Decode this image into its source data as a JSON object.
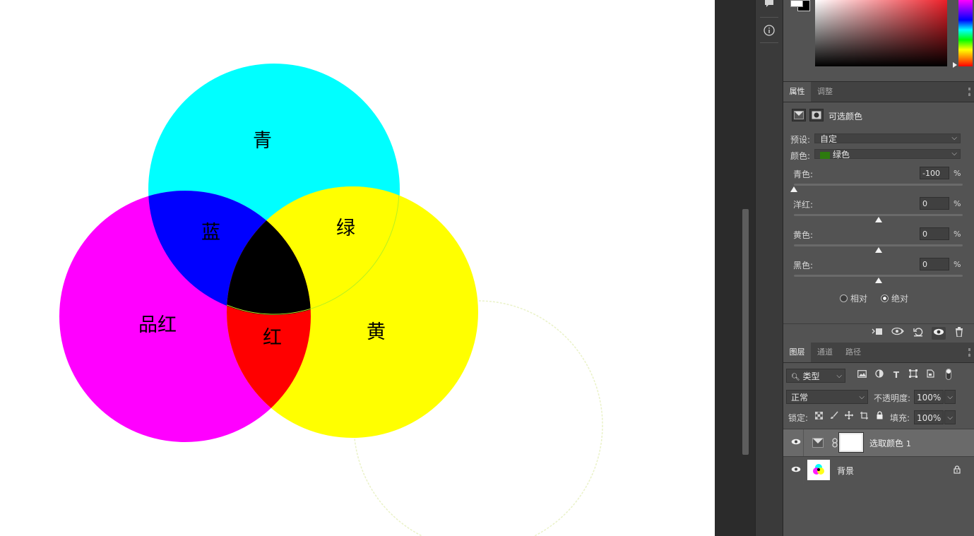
{
  "canvas": {
    "labels": {
      "cyan": "青",
      "blue": "蓝",
      "green": "绿",
      "magenta": "品红",
      "red": "红",
      "yellow": "黄"
    },
    "colors": {
      "cyan": "#00ffff",
      "blue": "#0000ff",
      "green_area": "#ffff00",
      "magenta": "#ff00ff",
      "red": "#ff0000",
      "yellow": "#ffff00",
      "center": "#000000",
      "ghost_circle": "#e6f0c0"
    }
  },
  "toolstrip": {
    "icons": [
      "comment-icon",
      "info-icon"
    ]
  },
  "properties_panel": {
    "tabs": [
      {
        "label": "属性",
        "active": true
      },
      {
        "label": "调整",
        "active": false
      }
    ],
    "adjustment_title": "可选颜色",
    "preset_label": "预设:",
    "preset_value": "自定",
    "color_label": "颜色:",
    "color_value": "绿色",
    "color_chip": "#2d7a0e",
    "sliders": [
      {
        "label": "青色:",
        "value": "-100",
        "unit": "%",
        "position": 0.0
      },
      {
        "label": "洋红:",
        "value": "0",
        "unit": "%",
        "position": 0.5
      },
      {
        "label": "黄色:",
        "value": "0",
        "unit": "%",
        "position": 0.5
      },
      {
        "label": "黑色:",
        "value": "0",
        "unit": "%",
        "position": 0.5
      }
    ],
    "method": {
      "relative_label": "相对",
      "absolute_label": "绝对",
      "selected": "absolute"
    },
    "footer_icons": [
      "clip-to-layer-icon",
      "view-previous-icon",
      "reset-icon",
      "visibility-icon",
      "trash-icon"
    ]
  },
  "layers_panel": {
    "tabs": [
      {
        "label": "图层",
        "active": true
      },
      {
        "label": "通道",
        "active": false
      },
      {
        "label": "路径",
        "active": false
      }
    ],
    "filter_type": "类型",
    "blend_mode": "正常",
    "opacity_label": "不透明度:",
    "opacity_value": "100%",
    "lock_label": "锁定:",
    "fill_label": "填充:",
    "fill_value": "100%",
    "layers": [
      {
        "name": "选取颜色",
        "suffix": "1",
        "visible": true,
        "selected": true
      },
      {
        "name": "背景",
        "visible": true,
        "selected": false,
        "locked": true
      }
    ]
  }
}
